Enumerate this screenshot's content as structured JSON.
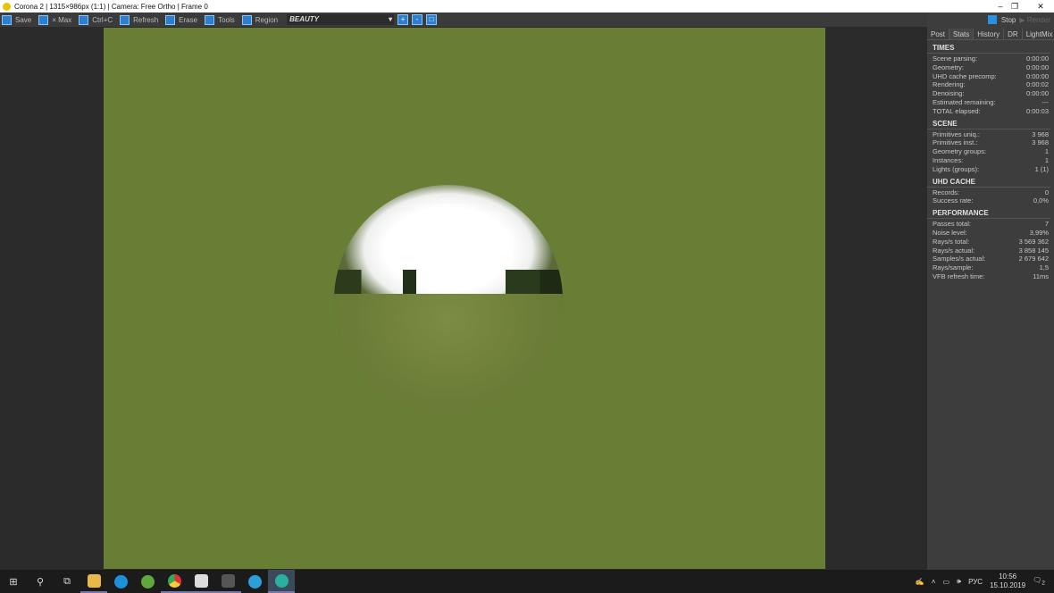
{
  "window": {
    "title": "Corona 2 | 1315×986px (1:1) | Camera: Free Ortho | Frame 0"
  },
  "toolbar": {
    "save": "Save",
    "max": "× Max",
    "copy": "Ctrl+C",
    "refresh": "Refresh",
    "erase": "Erase",
    "tools": "Tools",
    "region": "Region",
    "channel": "BEAUTY"
  },
  "panel": {
    "stop": "Stop",
    "render": "Render",
    "tabs": [
      "Post",
      "Stats",
      "History",
      "DR",
      "LightMix"
    ],
    "sections": [
      {
        "title": "TIMES",
        "rows": [
          [
            "Scene parsing:",
            "0:00:00"
          ],
          [
            "Geometry:",
            "0:00:00"
          ],
          [
            "UHD cache precomp:",
            "0:00:00"
          ],
          [
            "Rendering:",
            "0:00:02"
          ],
          [
            "Denoising:",
            "0:00:00"
          ],
          [
            "Estimated remaining:",
            "---"
          ],
          [
            "TOTAL elapsed:",
            "0:00:03"
          ]
        ]
      },
      {
        "title": "SCENE",
        "rows": [
          [
            "Primitives uniq.:",
            "3 968"
          ],
          [
            "Primitives inst.:",
            "3 968"
          ],
          [
            "Geometry groups:",
            "1"
          ],
          [
            "Instances:",
            "1"
          ],
          [
            "Lights (groups):",
            "1 (1)"
          ]
        ]
      },
      {
        "title": "UHD CACHE",
        "rows": [
          [
            "Records:",
            "0"
          ],
          [
            "Success rate:",
            "0,0%"
          ]
        ]
      },
      {
        "title": "PERFORMANCE",
        "rows": [
          [
            "Passes total:",
            "7"
          ],
          [
            "Noise level:",
            "3,99%"
          ],
          [
            "Rays/s total:",
            "3 569 362"
          ],
          [
            "Rays/s actual:",
            "3 858 145"
          ],
          [
            "Samples/s actual:",
            "2 679 642"
          ],
          [
            "Rays/sample:",
            "1,5"
          ],
          [
            "VFB refresh time:",
            "11ms"
          ]
        ]
      }
    ]
  },
  "taskbar": {
    "lang": "РУС",
    "time": "10:56",
    "date": "15.10.2019",
    "notif_count": "2"
  },
  "colors": {
    "render_bg": "#677e34",
    "accent": "#2b8fe0"
  }
}
